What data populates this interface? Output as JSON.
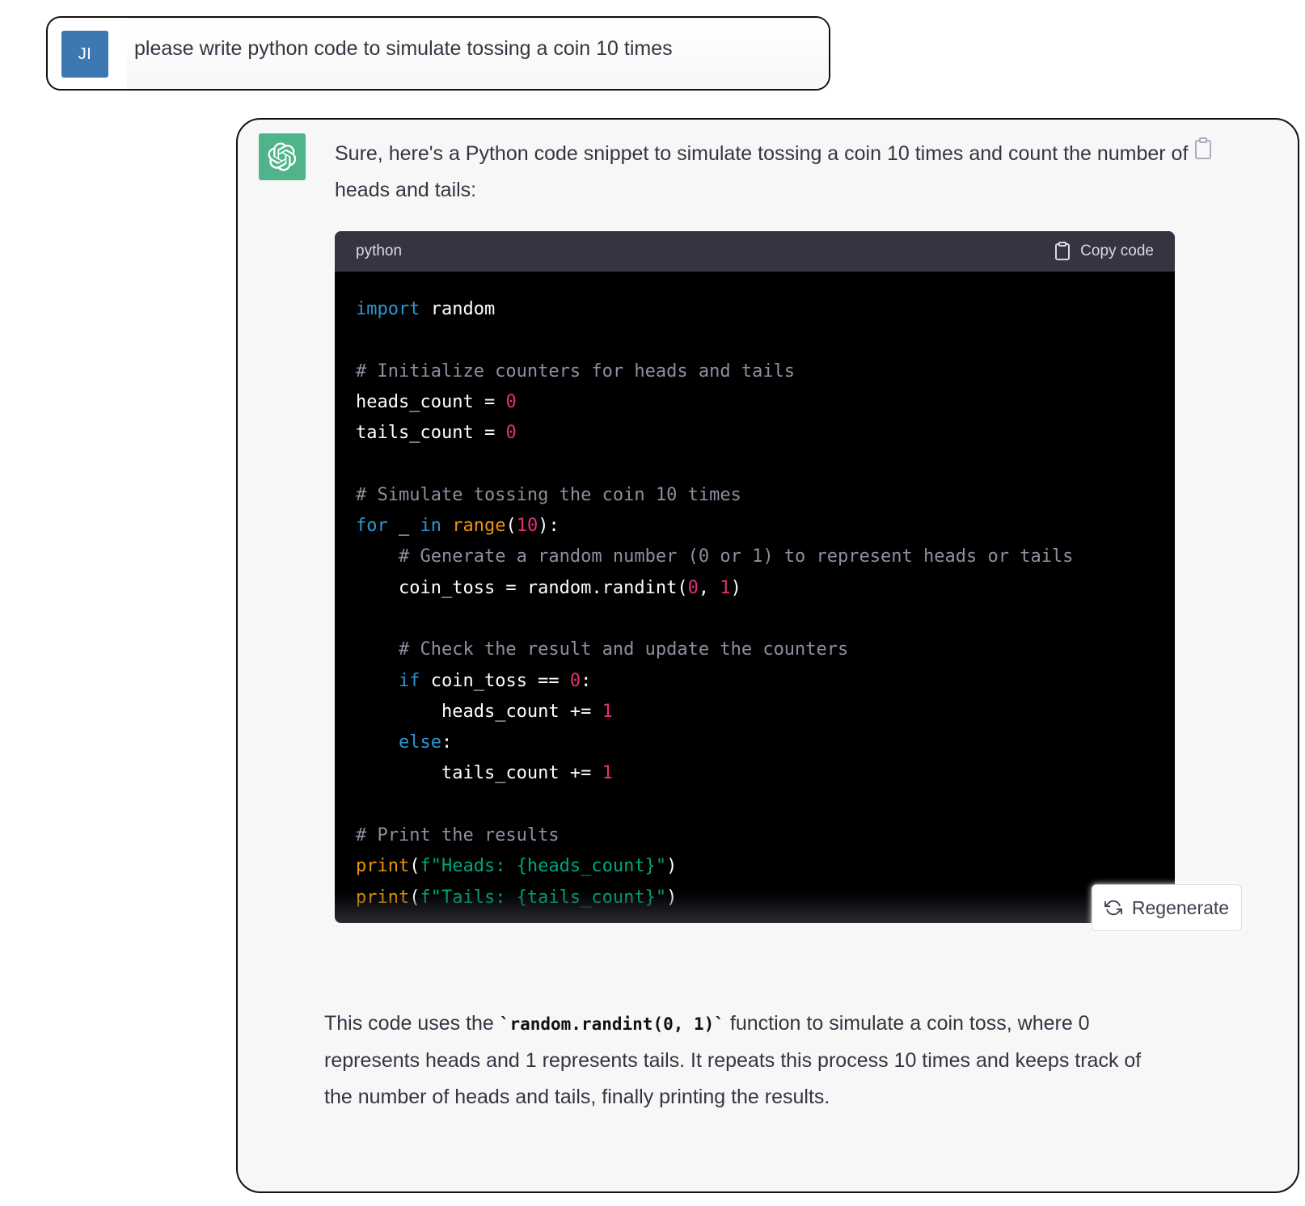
{
  "user_message": {
    "avatar_initials": "JI",
    "avatar_color": "#3c78b2",
    "text": "please write python code to simulate tossing a coin 10 times"
  },
  "assistant_message": {
    "avatar_icon": "openai-logo-icon",
    "avatar_color": "#4fb489",
    "intro": "Sure, here's a Python code snippet to simulate tossing a coin 10 times and count the number of heads and tails:",
    "code_block": {
      "language": "python",
      "copy_label": "Copy code"
    },
    "outro_before": "This code uses the ",
    "outro_code": "`random.randint(0, 1)`",
    "outro_after": " function to simulate a coin toss, where 0 represents heads and 1 represents tails. It repeats this process 10 times and keeps track of the number of heads and tails, finally printing the results."
  },
  "regenerate": {
    "label": "Regenerate"
  },
  "code_tokens": {
    "kw_import": "import",
    "mod_random": " random",
    "comment_init": "# Initialize counters for heads and tails",
    "heads_init": "heads_count = ",
    "tails_init": "tails_count = ",
    "zero": "0",
    "one": "1",
    "ten": "10",
    "comment_sim": "# Simulate tossing the coin 10 times",
    "kw_for": "for",
    "underscore": " _ ",
    "kw_in": "in",
    "space": " ",
    "bi_range": "range",
    "lparen": "(",
    "rparen_colon": "):",
    "comment_gen": "# Generate a random number (0 or 1) to represent heads or tails",
    "coin_assign": "coin_toss = random.randint(",
    "comma_space": ", ",
    "rparen": ")",
    "comment_check": "# Check the result and update the counters",
    "kw_if": "if",
    "cond": " coin_toss == ",
    "colon": ":",
    "heads_inc": "heads_count += ",
    "kw_else": "else",
    "tails_inc": "tails_count += ",
    "comment_print": "# Print the results",
    "bi_print": "print",
    "str_heads": "f\"Heads: {heads_count}\"",
    "str_tails": "f\"Tails: {tails_count}\""
  }
}
